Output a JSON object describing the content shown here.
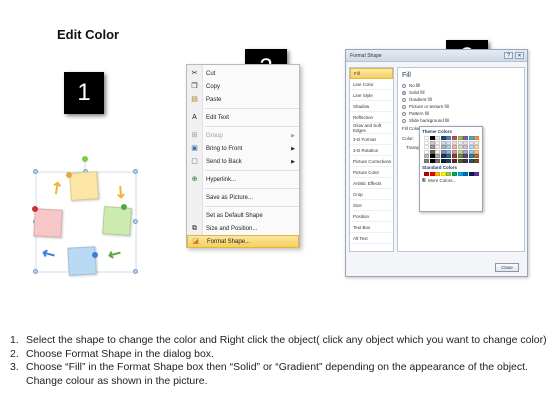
{
  "title": "Edit Color",
  "steps_badges": [
    "1",
    "2",
    "3"
  ],
  "context_menu": {
    "items": [
      {
        "label": "Cut",
        "icon": "scissors-icon",
        "disabled": false,
        "submenu": false
      },
      {
        "label": "Copy",
        "icon": "copy-icon",
        "disabled": false,
        "submenu": false
      },
      {
        "label": "Paste",
        "icon": "paste-icon",
        "disabled": false,
        "submenu": false
      },
      {
        "label": "Edit Text",
        "icon": "edit-text-icon",
        "disabled": false,
        "submenu": false
      },
      {
        "label": "Group",
        "icon": "group-icon",
        "disabled": true,
        "submenu": true
      },
      {
        "label": "Bring to Front",
        "icon": "bring-front-icon",
        "disabled": false,
        "submenu": true
      },
      {
        "label": "Send to Back",
        "icon": "send-back-icon",
        "disabled": false,
        "submenu": true
      },
      {
        "label": "Hyperlink...",
        "icon": "hyperlink-icon",
        "disabled": false,
        "submenu": false
      },
      {
        "label": "Save as Picture...",
        "icon": "",
        "disabled": false,
        "submenu": false
      },
      {
        "label": "Set as Default Shape",
        "icon": "",
        "disabled": false,
        "submenu": false
      },
      {
        "label": "Size and Position...",
        "icon": "size-position-icon",
        "disabled": false,
        "submenu": false
      },
      {
        "label": "Format Shape...",
        "icon": "format-shape-icon",
        "disabled": false,
        "submenu": false,
        "highlighted": true
      }
    ]
  },
  "format_dialog": {
    "title": "Format Shape",
    "nav_items": [
      "Fill",
      "Line Color",
      "Line Style",
      "Shadow",
      "Reflection",
      "Glow and Soft Edges",
      "3-D Format",
      "3-D Rotation",
      "Picture Corrections",
      "Picture Color",
      "Artistic Effects",
      "Crop",
      "Size",
      "Position",
      "Text Box",
      "Alt Text"
    ],
    "active_nav": "Fill",
    "panel_heading": "Fill",
    "fill_options": [
      {
        "label": "No fill",
        "selected": false
      },
      {
        "label": "Solid fill",
        "selected": true
      },
      {
        "label": "Gradient fill",
        "selected": false
      },
      {
        "label": "Picture or texture fill",
        "selected": false
      },
      {
        "label": "Pattern fill",
        "selected": false
      },
      {
        "label": "Slide background fill",
        "selected": false
      }
    ],
    "fill_color_label": "Fill Color",
    "color_label": "Color:",
    "transparency_label": "Transparency:",
    "theme_colors_label": "Theme Colors",
    "standard_colors_label": "Standard Colors",
    "more_colors_label": "More Colors...",
    "close_label": "Close",
    "theme_top_row": [
      "#ffffff",
      "#000000",
      "#eeece1",
      "#1f497d",
      "#4f81bd",
      "#c0504d",
      "#9bbb59",
      "#8064a2",
      "#4bacc6",
      "#f79646"
    ],
    "standard_colors": [
      "#c00000",
      "#ff0000",
      "#ffc000",
      "#ffff00",
      "#92d050",
      "#00b050",
      "#00b0f0",
      "#0070c0",
      "#002060",
      "#7030a0"
    ]
  },
  "instructions": [
    {
      "num": "1.",
      "text": "Select the shape to change the color and Right click the object( click any object which you want to change color)"
    },
    {
      "num": "2.",
      "text": "Choose Format Shape in the dialog box."
    },
    {
      "num": "3.",
      "text": "Choose “Fill” in the Format Shape box then “Solid” or “Gradient” depending on the appearance of the object. Change colour as shown in the picture."
    }
  ]
}
